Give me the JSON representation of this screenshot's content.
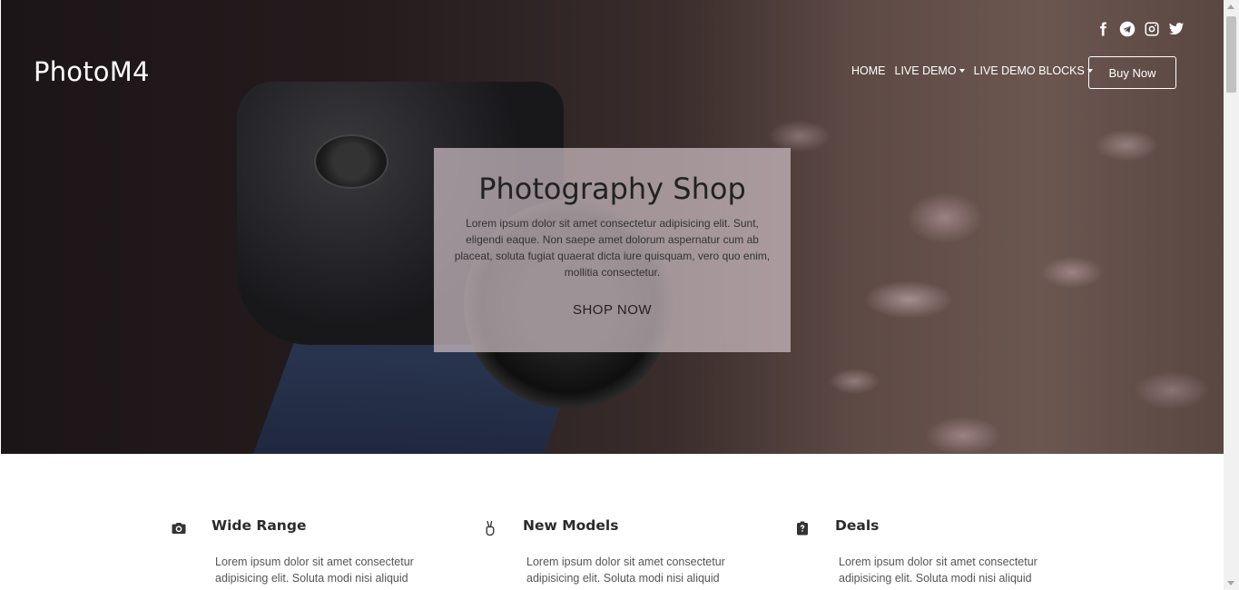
{
  "brand": "PhotoM4",
  "social": [
    {
      "icon": "facebook-icon"
    },
    {
      "icon": "telegram-icon"
    },
    {
      "icon": "instagram-icon"
    },
    {
      "icon": "twitter-icon"
    }
  ],
  "nav": {
    "home": "HOME",
    "live_demo": "LIVE DEMO",
    "live_demo_blocks": "LIVE DEMO BLOCKS",
    "buy_now": "Buy Now"
  },
  "hero": {
    "title": "Photography Shop",
    "text": "Lorem ipsum dolor sit amet consectetur adipisicing elit. Sunt, eligendi eaque. Non saepe amet dolorum aspernatur cum ab placeat, soluta fugiat quaerat dicta iure quisquam, vero quo enim, mollitia consectetur.",
    "cta": "SHOP NOW"
  },
  "features": [
    {
      "icon": "camera-icon",
      "title": "Wide Range",
      "text": "Lorem ipsum dolor sit amet consectetur adipisicing elit. Soluta modi nisi aliquid"
    },
    {
      "icon": "peace-hand-icon",
      "title": "New Models",
      "text": "Lorem ipsum dolor sit amet consectetur adipisicing elit. Soluta modi nisi aliquid"
    },
    {
      "icon": "clipboard-icon",
      "title": "Deals",
      "text": "Lorem ipsum dolor sit amet consectetur adipisicing elit. Soluta modi nisi aliquid"
    }
  ],
  "colors": {
    "overlay": "#cdbec3",
    "text_dark": "#222222",
    "white": "#ffffff"
  }
}
